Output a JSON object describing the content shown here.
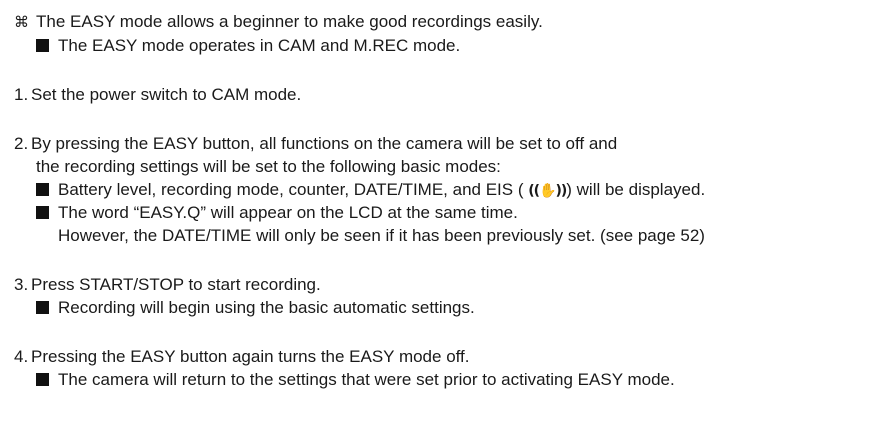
{
  "intro": {
    "symbol": "⌘",
    "text": "The EASY mode allows a beginner to make good recordings easily.",
    "sub": "The EASY mode operates in CAM and M.REC mode."
  },
  "steps": [
    {
      "num": "1.",
      "text": "Set the power switch to CAM mode."
    },
    {
      "num": "2.",
      "text": "By pressing the EASY button, all functions on the camera will be set to off and",
      "text_cont": "the recording settings will be set to the following basic modes:",
      "bullets": [
        {
          "before_icon": "Battery level, recording mode, counter, DATE/TIME, and EIS (",
          "icon_glyph": "((✋))",
          "after_icon": ") will be displayed."
        },
        {
          "text": "The word “EASY.Q” will appear on the LCD at the same time.",
          "cont": "However, the DATE/TIME will only be seen if it has been previously set. (see page 52)"
        }
      ]
    },
    {
      "num": "3.",
      "text": "Press START/STOP to start recording.",
      "bullets": [
        {
          "text": "Recording will begin using the basic automatic settings."
        }
      ]
    },
    {
      "num": "4.",
      "text": "Pressing the EASY button again turns the EASY mode off.",
      "bullets": [
        {
          "text": "The camera will return to the settings that were set prior to activating EASY mode."
        }
      ]
    }
  ]
}
